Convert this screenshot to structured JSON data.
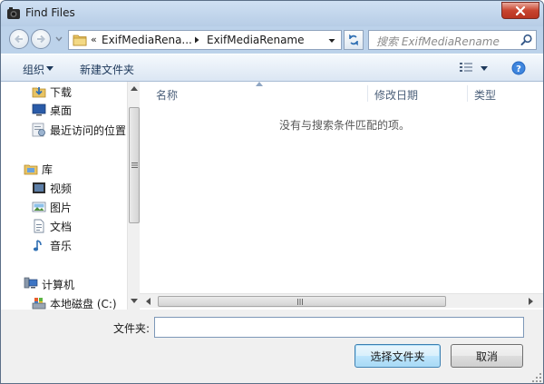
{
  "window": {
    "title": "Find Files",
    "close_label": "✕"
  },
  "navigation": {
    "address": {
      "chevron": "«",
      "segments": [
        "ExifMediaRena...",
        "ExifMediaRename"
      ]
    },
    "search": {
      "placeholder": "搜索 ExifMediaRename"
    }
  },
  "toolbar": {
    "organize_label": "组织",
    "new_folder_label": "新建文件夹"
  },
  "sidebar": {
    "items": [
      {
        "label": "下载",
        "icon": "download-folder-icon"
      },
      {
        "label": "桌面",
        "icon": "desktop-icon"
      },
      {
        "label": "最近访问的位置",
        "icon": "recent-places-icon"
      },
      {
        "label": "库",
        "icon": "libraries-icon"
      },
      {
        "label": "视频",
        "icon": "videos-icon"
      },
      {
        "label": "图片",
        "icon": "pictures-icon"
      },
      {
        "label": "文档",
        "icon": "documents-icon"
      },
      {
        "label": "音乐",
        "icon": "music-icon"
      },
      {
        "label": "计算机",
        "icon": "computer-icon"
      },
      {
        "label": "本地磁盘 (C:)",
        "icon": "local-disk-icon"
      }
    ]
  },
  "file_list": {
    "columns": [
      "名称",
      "修改日期",
      "类型"
    ],
    "empty_message": "没有与搜索条件匹配的项。"
  },
  "footer": {
    "folder_label": "文件夹:",
    "folder_value": "",
    "select_button": "选择文件夹",
    "cancel_button": "取消"
  },
  "colors": {
    "accent": "#3c7fb1",
    "link_text": "#1e395b"
  }
}
